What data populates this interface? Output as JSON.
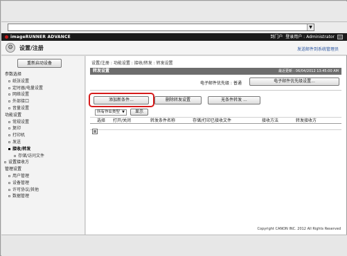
{
  "address_bar": {
    "dropdown_arrow": "▼"
  },
  "header": {
    "brand": "imageRUNNER ADVANCE",
    "portal_link": "到门户",
    "login_user_label": "登录用户 : Administrator",
    "logout_icon": "logout-icon"
  },
  "title_bar": {
    "title": "设置/注册",
    "send_mail_link": "发送邮件到系统管理员"
  },
  "sidebar": {
    "restart_button": "重新启动设备",
    "nav": [
      {
        "type": "group",
        "label": "参数选择"
      },
      {
        "type": "item",
        "label": "纸张设置"
      },
      {
        "type": "item",
        "label": "定时器/电量设置"
      },
      {
        "type": "item",
        "label": "网络设置"
      },
      {
        "type": "item",
        "label": "外部接口"
      },
      {
        "type": "item",
        "label": "音量设置"
      },
      {
        "type": "group",
        "label": "功能设置"
      },
      {
        "type": "item",
        "label": "常规设置"
      },
      {
        "type": "item",
        "label": "复印"
      },
      {
        "type": "item",
        "label": "打印机"
      },
      {
        "type": "item",
        "label": "发送"
      },
      {
        "type": "item",
        "label": "接收/转发",
        "active": true
      },
      {
        "type": "item",
        "label": "存储/访问文件"
      },
      {
        "type": "top",
        "label": "设置接收方"
      },
      {
        "type": "group",
        "label": "管理设置"
      },
      {
        "type": "item",
        "label": "用户管理"
      },
      {
        "type": "item",
        "label": "设备管理"
      },
      {
        "type": "item",
        "label": "许可协议/其他"
      },
      {
        "type": "item",
        "label": "数据管理"
      }
    ]
  },
  "main": {
    "breadcrumb": "设置/注册 : 功能设置 : 接收/转发 : 转发设置",
    "panel_title": "转发设置",
    "last_updated": "最近更新 : 06/04/2012 13:45:00 AM",
    "priority_label": "电子邮件优先级 : 普通",
    "priority_button": "电子邮件优先级设置...",
    "add_condition_button": "添加新条件...",
    "delete_button": "删除转发设置",
    "unconditional_button": "无条件转发 ...",
    "filter_select": "所有作业类型",
    "filter_arrow": "▼",
    "show_button": "显示",
    "table_columns": [
      "选择",
      "打开/关闭",
      "转发条件名称",
      "存储/打印已接收文件",
      "接收方法",
      "转发接收方"
    ],
    "copyright": "Copyright CANON INC. 2012 All Rights Reserved"
  },
  "colors": {
    "highlight": "#d61a1a",
    "header_bg": "#1b1b1b",
    "panel_head": "#6d6d6d",
    "brand_dot": "#c31a1a"
  }
}
